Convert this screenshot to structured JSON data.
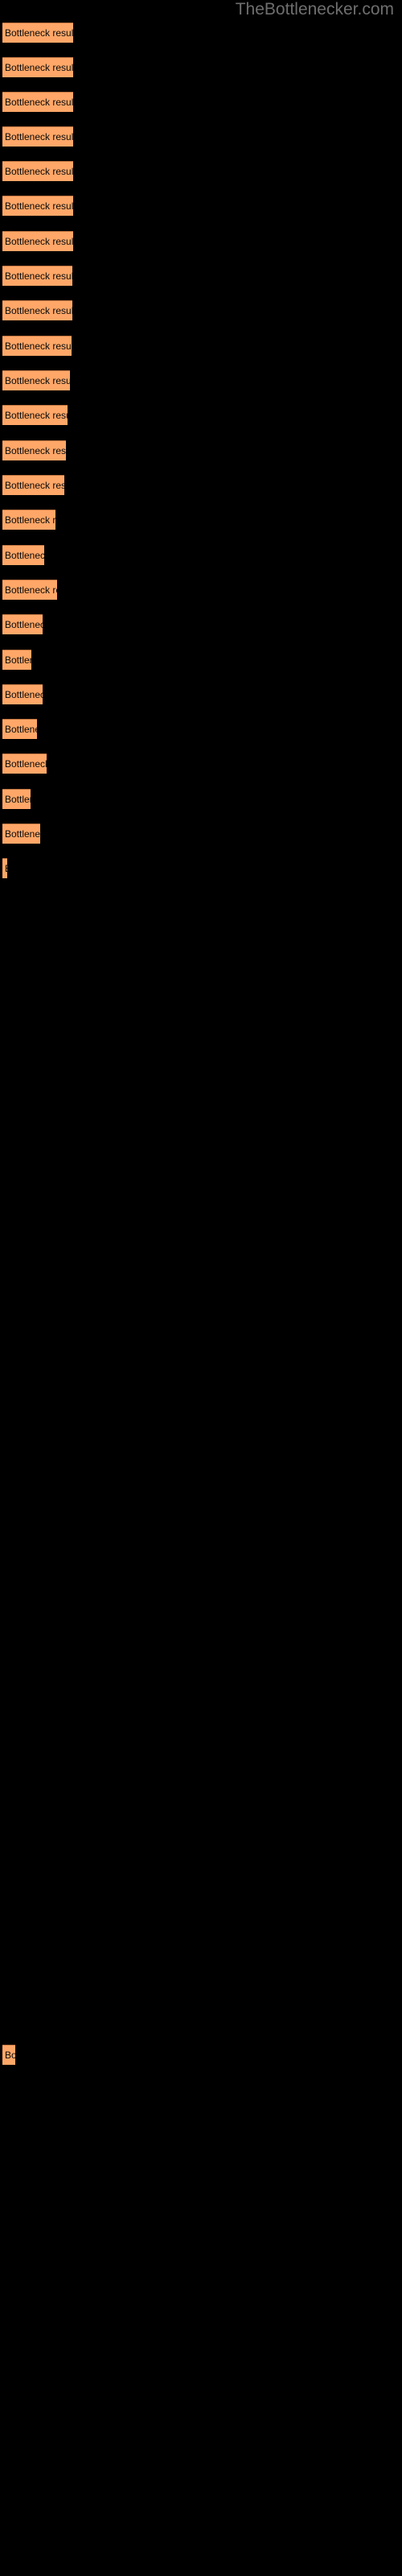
{
  "header": {
    "site_title": "TheBottlenecker.com"
  },
  "colors": {
    "background": "#000000",
    "bar_fill": "#ffa768",
    "bar_top_border": "#bf7340",
    "bar_label_text": "#0a0a0a",
    "title_text": "#6e6e6e"
  },
  "chart_data": {
    "type": "bar",
    "orientation": "horizontal",
    "title": "TheBottlenecker.com",
    "xlabel": "",
    "ylabel": "",
    "grid": false,
    "legend": null,
    "bar_label": "Bottleneck result",
    "categories": [
      "Bottleneck result",
      "Bottleneck result",
      "Bottleneck result",
      "Bottleneck result",
      "Bottleneck result",
      "Bottleneck result",
      "Bottleneck result",
      "Bottleneck result",
      "Bottleneck result",
      "Bottleneck result",
      "Bottleneck result",
      "Bottleneck result",
      "Bottleneck result",
      "Bottleneck result",
      "Bottleneck result",
      "Bottleneck result",
      "Bottleneck result",
      "Bottleneck result",
      "Bottleneck result",
      "Bottleneck result",
      "Bottleneck result",
      "Bottleneck result",
      "Bottleneck result",
      "Bottleneck result",
      "Bottleneck result",
      "Bottleneck result",
      "Bottleneck result",
      "Bottleneck result",
      "Bottleneck result"
    ],
    "values": [
      88,
      88,
      88,
      88,
      88,
      88,
      88,
      88,
      88,
      86,
      84,
      81,
      79,
      77,
      66,
      52,
      68,
      50,
      36,
      50,
      43,
      55,
      35,
      47,
      6,
      4,
      3,
      3,
      16
    ],
    "xlim": [
      0,
      500
    ]
  },
  "bars": [
    {
      "y": 28,
      "width": 88,
      "label": "Bottleneck result"
    },
    {
      "y": 71,
      "width": 88,
      "label": "Bottleneck result"
    },
    {
      "y": 114,
      "width": 88,
      "label": "Bottleneck result"
    },
    {
      "y": 157,
      "width": 88,
      "label": "Bottleneck result"
    },
    {
      "y": 200,
      "width": 88,
      "label": "Bottleneck result"
    },
    {
      "y": 243,
      "width": 88,
      "label": "Bottleneck result"
    },
    {
      "y": 287,
      "width": 88,
      "label": "Bottleneck result"
    },
    {
      "y": 330,
      "width": 87,
      "label": "Bottleneck result"
    },
    {
      "y": 373,
      "width": 87,
      "label": "Bottleneck result"
    },
    {
      "y": 417,
      "width": 86,
      "label": "Bottleneck result"
    },
    {
      "y": 460,
      "width": 84,
      "label": "Bottleneck result"
    },
    {
      "y": 503,
      "width": 81,
      "label": "Bottleneck result"
    },
    {
      "y": 547,
      "width": 79,
      "label": "Bottleneck result"
    },
    {
      "y": 590,
      "width": 77,
      "label": "Bottleneck result"
    },
    {
      "y": 633,
      "width": 66,
      "label": "Bottleneck result"
    },
    {
      "y": 677,
      "width": 52,
      "label": "Bottleneck result"
    },
    {
      "y": 720,
      "width": 68,
      "label": "Bottleneck result"
    },
    {
      "y": 763,
      "width": 50,
      "label": "Bottleneck result"
    },
    {
      "y": 807,
      "width": 36,
      "label": "Bottleneck result"
    },
    {
      "y": 850,
      "width": 50,
      "label": "Bottleneck result"
    },
    {
      "y": 893,
      "width": 43,
      "label": "Bottleneck result"
    },
    {
      "y": 936,
      "width": 55,
      "label": "Bottleneck result"
    },
    {
      "y": 980,
      "width": 35,
      "label": "Bottleneck result"
    },
    {
      "y": 1023,
      "width": 47,
      "label": "Bottleneck result"
    },
    {
      "y": 1066,
      "width": 6,
      "label": "Bottleneck result"
    },
    {
      "y": 2540,
      "width": 16,
      "label": "Bottleneck result"
    }
  ]
}
